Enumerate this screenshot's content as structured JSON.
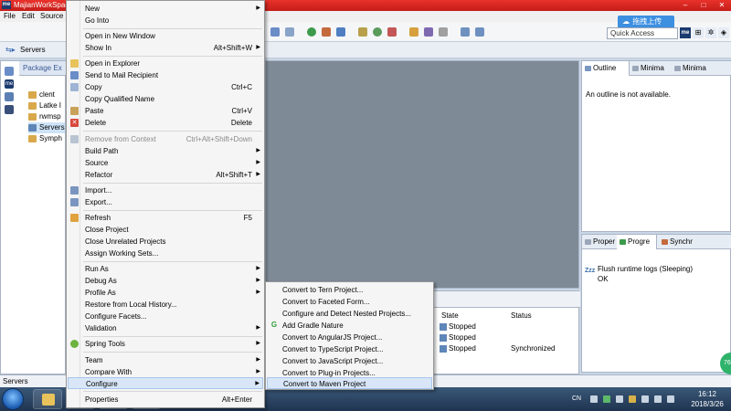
{
  "window": {
    "title": "MajianWorkSpac",
    "badge": "me"
  },
  "menubar": {
    "file": "File",
    "edit": "Edit",
    "source": "Source"
  },
  "toolbar": {
    "cloud_upload": "拖拽上传",
    "quick_access": "Quick Access"
  },
  "breadcrumb": {
    "label": "Servers"
  },
  "package_explorer": {
    "tab": "Package Ex",
    "items": [
      "clent",
      "Latke I",
      "rwmsp",
      "Servers",
      "Symph"
    ]
  },
  "context_menu": {
    "new": "New",
    "go_into": "Go Into",
    "open_new_window": "Open in New Window",
    "show_in": "Show In",
    "show_in_shortcut": "Alt+Shift+W",
    "open_explorer": "Open in Explorer",
    "send_mail": "Send to Mail Recipient",
    "copy": "Copy",
    "copy_shortcut": "Ctrl+C",
    "copy_qualified": "Copy Qualified Name",
    "paste": "Paste",
    "paste_shortcut": "Ctrl+V",
    "delete": "Delete",
    "delete_shortcut": "Delete",
    "remove_context": "Remove from Context",
    "remove_context_shortcut": "Ctrl+Alt+Shift+Down",
    "build_path": "Build Path",
    "source": "Source",
    "refactor": "Refactor",
    "refactor_shortcut": "Alt+Shift+T",
    "import": "Import...",
    "export": "Export...",
    "refresh": "Refresh",
    "refresh_shortcut": "F5",
    "close_project": "Close Project",
    "close_unrelated": "Close Unrelated Projects",
    "assign_working_sets": "Assign Working Sets...",
    "run_as": "Run As",
    "debug_as": "Debug As",
    "profile_as": "Profile As",
    "restore_history": "Restore from Local History...",
    "configure_facets": "Configure Facets...",
    "validation": "Validation",
    "spring_tools": "Spring Tools",
    "team": "Team",
    "compare_with": "Compare With",
    "configure": "Configure",
    "properties": "Properties",
    "properties_shortcut": "Alt+Enter"
  },
  "submenu": {
    "tern": "Convert to Tern Project...",
    "faceted": "Convert to Faceted Form...",
    "detect_nested": "Configure and Detect Nested Projects...",
    "gradle": "Add Gradle Nature",
    "angularjs": "Convert to AngularJS Project...",
    "typescript": "Convert to TypeScript Project...",
    "javascript": "Convert to JavaScript Project...",
    "plugin": "Convert to Plug-in Projects...",
    "maven": "Convert to Maven Project"
  },
  "outline": {
    "tabs": [
      "Outline",
      "Minima",
      "Minima"
    ],
    "message": "An outline is not available."
  },
  "progress": {
    "tabs": [
      "Proper",
      "Progre",
      "Synchr"
    ],
    "zzz": "Zzz",
    "job": "Flush runtime logs (Sleeping)",
    "ok": "OK"
  },
  "servers_view": {
    "headers": {
      "state": "State",
      "status": "Status"
    },
    "rows": [
      {
        "state": "Stopped",
        "status": ""
      },
      {
        "state": "Stopped",
        "status": ""
      },
      {
        "state": "Stopped",
        "status": "Synchronized"
      }
    ]
  },
  "statusline": {
    "text": "Servers"
  },
  "taskbar": {
    "lang": "CN",
    "time": "16:12",
    "date": "2018/3/26",
    "bubble": "76"
  },
  "colors": {
    "accent": "#3d8fe0",
    "titlebar": "#c51d19",
    "editor_bg": "#7e8a96"
  }
}
